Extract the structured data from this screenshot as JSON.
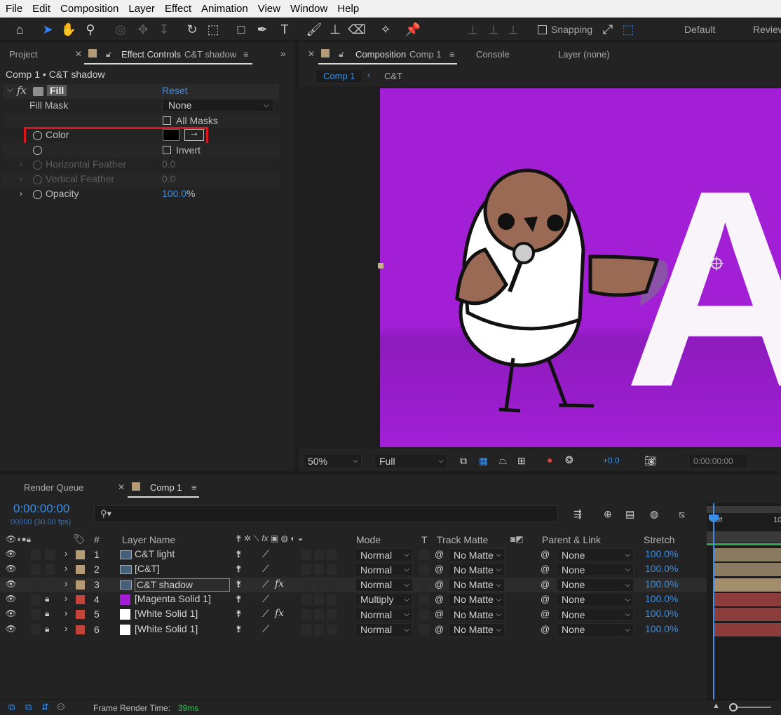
{
  "menu": [
    "File",
    "Edit",
    "Composition",
    "Layer",
    "Effect",
    "Animation",
    "View",
    "Window",
    "Help"
  ],
  "toolbar": {
    "snapping_label": "Snapping",
    "workspace_default": "Default",
    "workspace_review": "Review"
  },
  "effect_controls": {
    "tab_project": "Project",
    "tab_effect_label": "Effect Controls",
    "tab_effect_layer": "C&T shadow",
    "breadcrumb": "Comp 1 • C&T shadow",
    "effect_name": "Fill",
    "reset_label": "Reset",
    "fill_mask_label": "Fill Mask",
    "fill_mask_value": "None",
    "all_masks_label": "All Masks",
    "color_label": "Color",
    "color_value": "#000000",
    "invert_label": "Invert",
    "h_feather_label": "Horizontal Feather",
    "h_feather_value": "0.0",
    "v_feather_label": "Vertical Feather",
    "v_feather_value": "0.0",
    "opacity_label": "Opacity",
    "opacity_value": "100.0",
    "opacity_unit": "%"
  },
  "composition": {
    "tab_label": "Composition",
    "tab_comp": "Comp 1",
    "tab_console": "Console",
    "tab_layer": "Layer (none)",
    "crumb_active": "Comp 1",
    "crumb_next": "C&T",
    "background": "#a21fd6",
    "letter": "A",
    "zoom": "50%",
    "resolution": "Full",
    "exposure": "+0.0",
    "timecode": "0:00:00:00"
  },
  "timeline": {
    "tab_render_queue": "Render Queue",
    "tab_comp": "Comp 1",
    "current_time": "0:00:00:00",
    "frame_info": "00000 (30.00 fps)",
    "search_placeholder": "",
    "col_num": "#",
    "col_layer_name": "Layer Name",
    "col_mode": "Mode",
    "col_t": "T",
    "col_track_matte": "Track Matte",
    "col_parent": "Parent & Link",
    "col_stretch": "Stretch",
    "ruler_start": "0f",
    "ruler_next": "10",
    "layers": [
      {
        "num": "1",
        "name": "C&T light",
        "label_color": "#b49a75",
        "icon": "comp",
        "mode": "Normal",
        "matte": "No Matte",
        "parent": "None",
        "stretch": "100.0%",
        "fx": false,
        "locked": false,
        "bar": "#8a7a60"
      },
      {
        "num": "2",
        "name": "[C&T]",
        "label_color": "#b49a75",
        "icon": "comp",
        "mode": "Normal",
        "matte": "No Matte",
        "parent": "None",
        "stretch": "100.0%",
        "fx": false,
        "locked": false,
        "bar": "#8a7a60"
      },
      {
        "num": "3",
        "name": "C&T shadow",
        "label_color": "#b49a75",
        "icon": "comp",
        "mode": "Normal",
        "matte": "No Matte",
        "parent": "None",
        "stretch": "100.0%",
        "fx": true,
        "locked": false,
        "bar": "#a38e6c"
      },
      {
        "num": "4",
        "name": "[Magenta Solid 1]",
        "label_color": "#c2443a",
        "icon": "magenta",
        "mode": "Multiply",
        "matte": "No Matte",
        "parent": "None",
        "stretch": "100.0%",
        "fx": false,
        "locked": true,
        "bar": "#8d3c3c"
      },
      {
        "num": "5",
        "name": "[White Solid 1]",
        "label_color": "#c2443a",
        "icon": "white",
        "mode": "Normal",
        "matte": "No Matte",
        "parent": "None",
        "stretch": "100.0%",
        "fx": true,
        "locked": true,
        "bar": "#8d3c3c"
      },
      {
        "num": "6",
        "name": "[White Solid 1]",
        "label_color": "#c2443a",
        "icon": "white",
        "mode": "Normal",
        "matte": "No Matte",
        "parent": "None",
        "stretch": "100.0%",
        "fx": false,
        "locked": true,
        "bar": "#8d3c3c"
      }
    ]
  },
  "status": {
    "render_time_label": "Frame Render Time:",
    "render_time_value": "39ms"
  }
}
